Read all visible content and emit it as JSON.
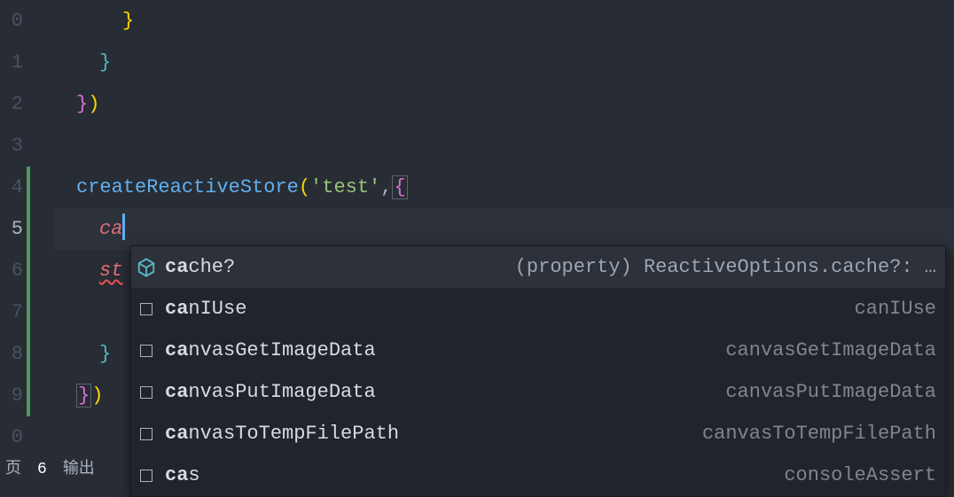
{
  "gutter": {
    "start_fragment": "0",
    "lines": [
      "1",
      "2",
      "3",
      "4",
      "5",
      "6",
      "7",
      "8",
      "9"
    ],
    "ten_fragment": "0",
    "active_index": 4
  },
  "code": {
    "l0_brace": "}",
    "l1_brace": "}",
    "l2_close": "})",
    "l4_func": "createReactiveStore",
    "l4_open_paren": "(",
    "l4_str": "'test'",
    "l4_comma": ",",
    "l4_open_brace": "{",
    "l5_typed": "ca",
    "l6_frag": "st",
    "l8_brace": "}",
    "l9_close": "})"
  },
  "suggest": {
    "selected_index": 0,
    "items": [
      {
        "icon": "cube",
        "label_prefix": "ca",
        "label_rest": "che?",
        "detail": "(property) ReactiveOptions.cache?: …"
      },
      {
        "icon": "square",
        "label_prefix": "ca",
        "label_rest": "nIUse",
        "detail": "canIUse"
      },
      {
        "icon": "square",
        "label_prefix": "ca",
        "label_rest": "nvasGetImageData",
        "detail": "canvasGetImageData"
      },
      {
        "icon": "square",
        "label_prefix": "ca",
        "label_rest": "nvasPutImageData",
        "detail": "canvasPutImageData"
      },
      {
        "icon": "square",
        "label_prefix": "ca",
        "label_rest": "nvasToTempFilePath",
        "detail": "canvasToTempFilePath"
      },
      {
        "icon": "square",
        "label_prefix": "ca",
        "label_rest": "s",
        "detail": "consoleAssert"
      }
    ]
  },
  "bottom": {
    "left_fragment": "页",
    "count": "6",
    "output_fragment": "输出"
  }
}
